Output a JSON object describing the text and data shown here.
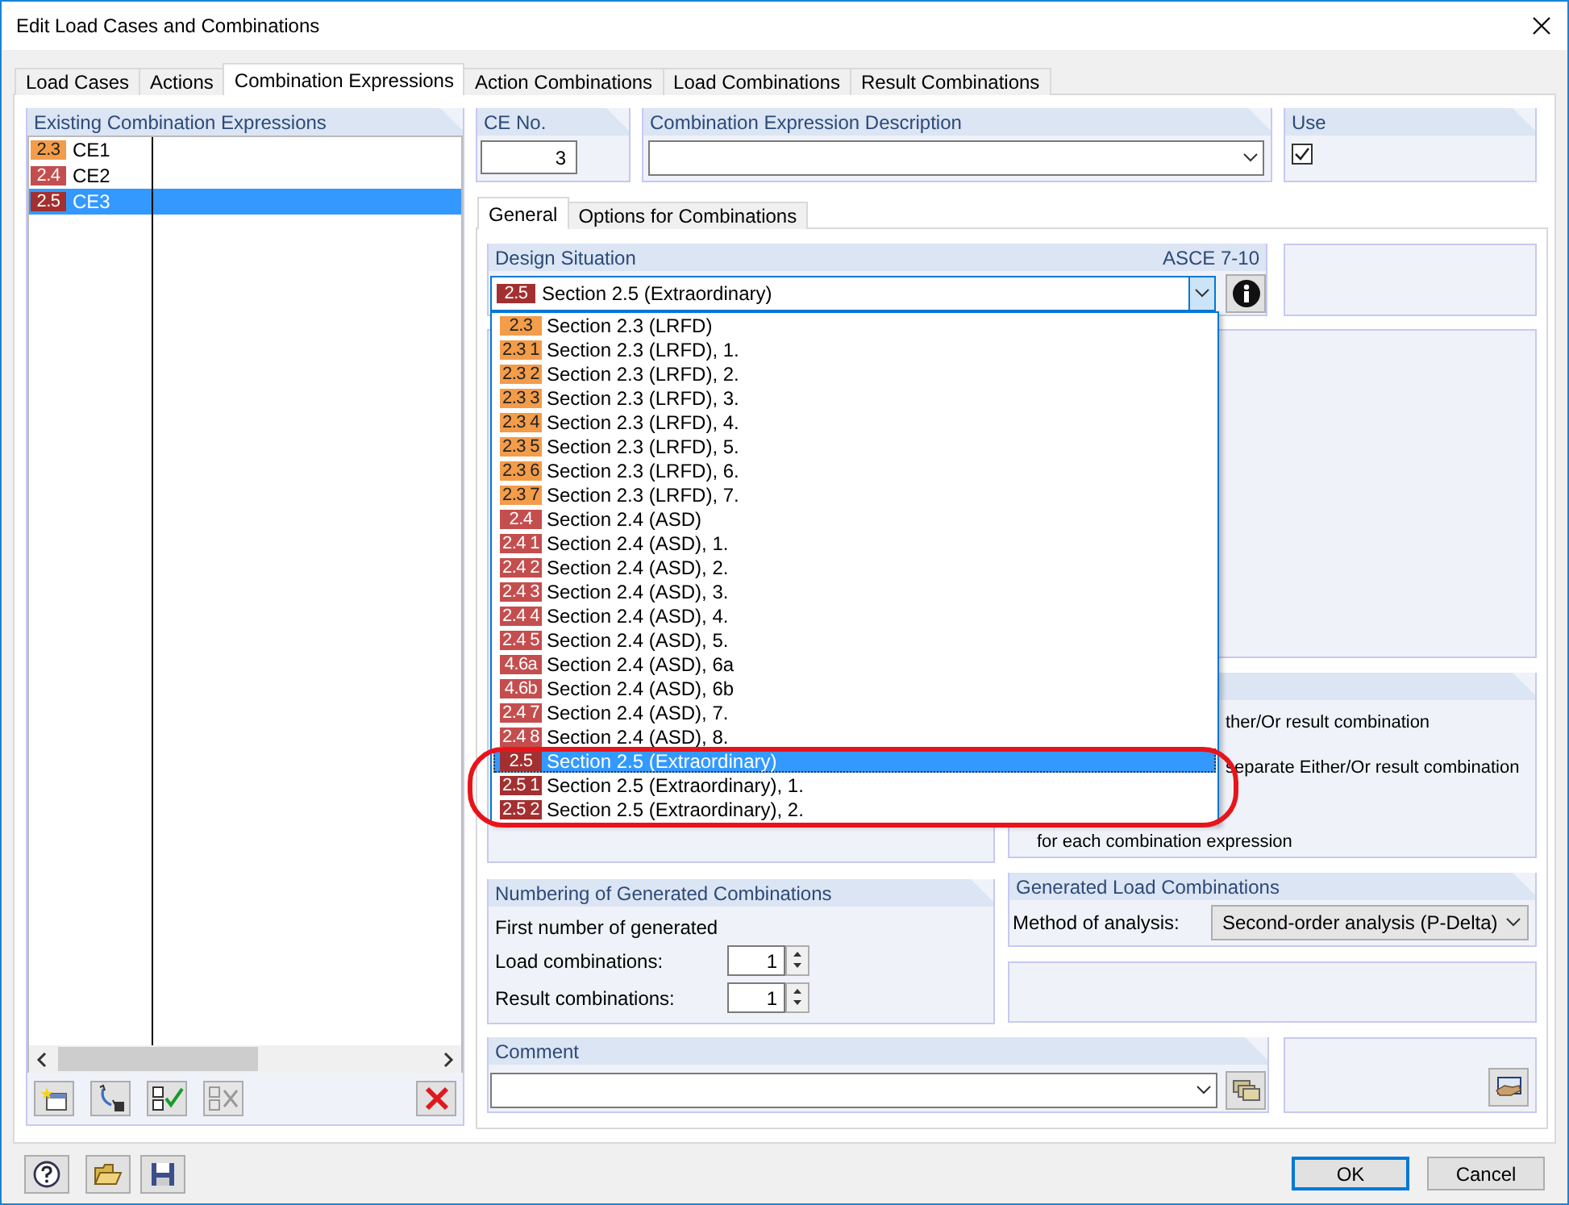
{
  "window": {
    "title": "Edit Load Cases and Combinations"
  },
  "tabs": [
    {
      "label": "Load Cases",
      "selected": false
    },
    {
      "label": "Actions",
      "selected": false
    },
    {
      "label": "Combination Expressions",
      "selected": true
    },
    {
      "label": "Action Combinations",
      "selected": false
    },
    {
      "label": "Load Combinations",
      "selected": false
    },
    {
      "label": "Result Combinations",
      "selected": false
    }
  ],
  "existing_expressions": {
    "title": "Existing Combination Expressions",
    "items": [
      {
        "badge": "2.3",
        "color": "#f39c4a",
        "name": "CE1",
        "selected": false
      },
      {
        "badge": "2.4",
        "color": "#c44e4e",
        "name": "CE2",
        "selected": false
      },
      {
        "badge": "2.5",
        "color": "#a33030",
        "name": "CE3",
        "selected": true
      }
    ]
  },
  "ce_no": {
    "label": "CE No.",
    "value": "3"
  },
  "description": {
    "label": "Combination Expression Description"
  },
  "use": {
    "label": "Use",
    "checked": true
  },
  "inner_tabs": [
    {
      "label": "General",
      "selected": true
    },
    {
      "label": "Options for Combinations",
      "selected": false
    }
  ],
  "design_situation": {
    "title": "Design Situation",
    "code": "ASCE 7-10",
    "value_badge": "2.5",
    "value": "Section 2.5 (Extraordinary)",
    "expanded": true,
    "options": [
      {
        "badge": "2.3",
        "color": "#f39c4a",
        "label": "Section 2.3 (LRFD)",
        "selected": false
      },
      {
        "badge": "2.3 1",
        "color": "#f39c4a",
        "label": "Section 2.3 (LRFD), 1.",
        "selected": false
      },
      {
        "badge": "2.3 2",
        "color": "#f39c4a",
        "label": "Section 2.3 (LRFD), 2.",
        "selected": false
      },
      {
        "badge": "2.3 3",
        "color": "#f39c4a",
        "label": "Section 2.3 (LRFD), 3.",
        "selected": false
      },
      {
        "badge": "2.3 4",
        "color": "#f39c4a",
        "label": "Section 2.3 (LRFD), 4.",
        "selected": false
      },
      {
        "badge": "2.3 5",
        "color": "#f39c4a",
        "label": "Section 2.3 (LRFD), 5.",
        "selected": false
      },
      {
        "badge": "2.3 6",
        "color": "#f39c4a",
        "label": "Section 2.3 (LRFD), 6.",
        "selected": false
      },
      {
        "badge": "2.3 7",
        "color": "#f39c4a",
        "label": "Section 2.3 (LRFD), 7.",
        "selected": false
      },
      {
        "badge": "2.4",
        "color": "#c44e4e",
        "label": "Section 2.4 (ASD)",
        "selected": false
      },
      {
        "badge": "2.4 1",
        "color": "#c44e4e",
        "label": "Section 2.4 (ASD), 1.",
        "selected": false
      },
      {
        "badge": "2.4 2",
        "color": "#c44e4e",
        "label": "Section 2.4 (ASD), 2.",
        "selected": false
      },
      {
        "badge": "2.4 3",
        "color": "#c44e4e",
        "label": "Section 2.4 (ASD), 3.",
        "selected": false
      },
      {
        "badge": "2.4 4",
        "color": "#c44e4e",
        "label": "Section 2.4 (ASD), 4.",
        "selected": false
      },
      {
        "badge": "2.4 5",
        "color": "#c44e4e",
        "label": "Section 2.4 (ASD), 5.",
        "selected": false
      },
      {
        "badge": "4.6a",
        "color": "#c44e4e",
        "label": "Section 2.4 (ASD), 6a",
        "selected": false
      },
      {
        "badge": "4.6b",
        "color": "#c44e4e",
        "label": "Section 2.4 (ASD), 6b",
        "selected": false
      },
      {
        "badge": "2.4 7",
        "color": "#c44e4e",
        "label": "Section 2.4 (ASD), 7.",
        "selected": false
      },
      {
        "badge": "2.4 8",
        "color": "#c44e4e",
        "label": "Section 2.4 (ASD), 8.",
        "selected": false
      },
      {
        "badge": "2.5",
        "color": "#a33030",
        "label": "Section 2.5 (Extraordinary)",
        "selected": true
      },
      {
        "badge": "2.5 1",
        "color": "#a33030",
        "label": "Section 2.5 (Extraordinary), 1.",
        "selected": false
      },
      {
        "badge": "2.5 2",
        "color": "#a33030",
        "label": "Section 2.5 (Extraordinary), 2.",
        "selected": false
      }
    ]
  },
  "result_options_partial": [
    "ther/Or result combination",
    "separate Either/Or result combination",
    "for each combination expression"
  ],
  "numbering": {
    "title": "Numbering of Generated Combinations",
    "subtitle": "First number of generated",
    "fields": [
      {
        "label": "Load combinations:",
        "value": "1"
      },
      {
        "label": "Result combinations:",
        "value": "1"
      }
    ]
  },
  "generated": {
    "title": "Generated Load Combinations",
    "method_label": "Method of analysis:",
    "method_value": "Second-order analysis (P-Delta)"
  },
  "comment": {
    "title": "Comment"
  },
  "buttons": [
    {
      "label": "OK",
      "default": true
    },
    {
      "label": "Cancel",
      "default": false
    }
  ]
}
